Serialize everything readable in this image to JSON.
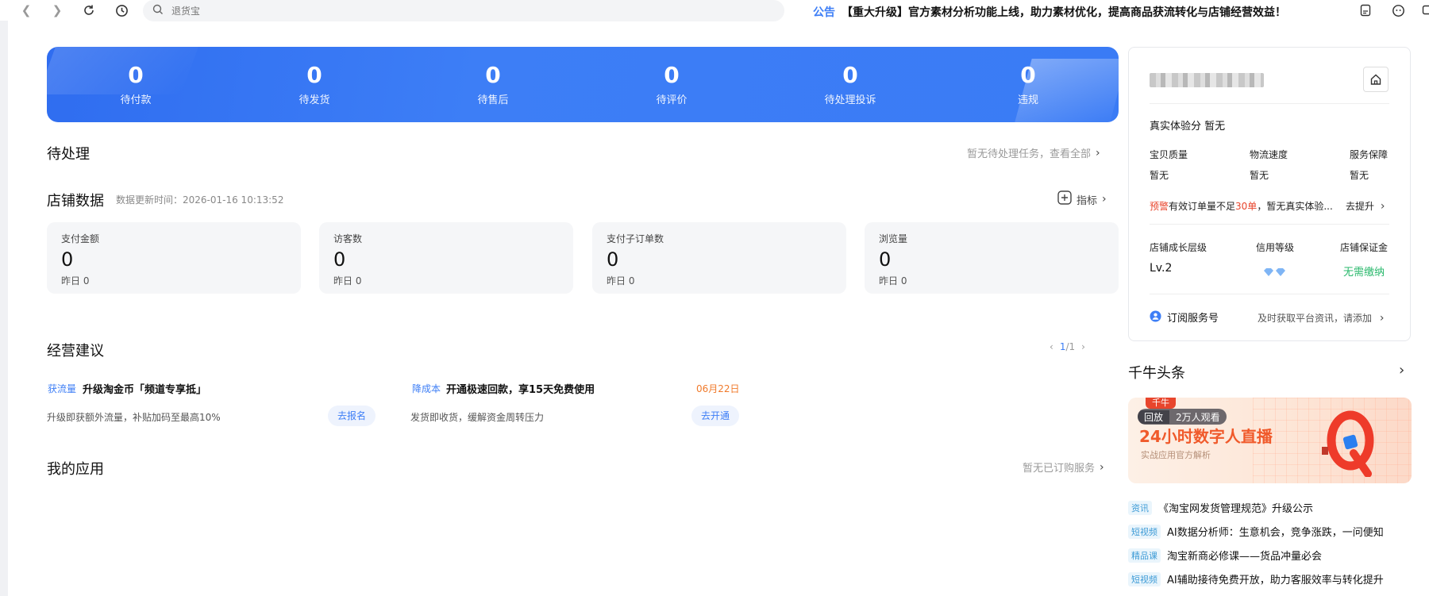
{
  "topbar": {
    "search_placeholder": "退货宝",
    "notice_label": "公告",
    "notice_text": "【重大升级】官方素材分析功能上线，助力素材优化，提高商品获流转化与店铺经营效益！"
  },
  "banner": {
    "stats": [
      {
        "value": "0",
        "label": "待付款"
      },
      {
        "value": "0",
        "label": "待发货"
      },
      {
        "value": "0",
        "label": "待售后"
      },
      {
        "value": "0",
        "label": "待评价"
      },
      {
        "value": "0",
        "label": "待处理投诉"
      },
      {
        "value": "0",
        "label": "违规"
      }
    ]
  },
  "pending": {
    "title": "待处理",
    "link": "暂无待处理任务，查看全部"
  },
  "shop_data": {
    "title": "店铺数据",
    "update_time": "数据更新时间：2026-01-16 10:13:52",
    "indicator_label": "指标",
    "metrics": [
      {
        "label": "支付金额",
        "value": "0",
        "yesterday": "昨日 0"
      },
      {
        "label": "访客数",
        "value": "0",
        "yesterday": "昨日 0"
      },
      {
        "label": "支付子订单数",
        "value": "0",
        "yesterday": "昨日 0"
      },
      {
        "label": "浏览量",
        "value": "0",
        "yesterday": "昨日 0"
      }
    ]
  },
  "suggestions": {
    "title": "经营建议",
    "pager": {
      "current": "1",
      "separator": "/",
      "total": "1"
    },
    "items": [
      {
        "tag": "获流量",
        "title": "升级淘金币「频道专享抵」",
        "desc": "升级即获额外流量，补贴加码至最高10%",
        "button": "去报名",
        "date": ""
      },
      {
        "tag": "降成本",
        "title": "开通极速回款，享15天免费使用",
        "desc": "发货即收货，缓解资金周转压力",
        "button": "去开通",
        "date": "06月22日"
      }
    ]
  },
  "my_apps": {
    "title": "我的应用",
    "link": "暂无已订购服务"
  },
  "shop_card": {
    "experience_score": "真实体验分  暂无",
    "scores": [
      {
        "label": "宝贝质量",
        "value": "暂无"
      },
      {
        "label": "物流速度",
        "value": "暂无"
      },
      {
        "label": "服务保障",
        "value": "暂无"
      }
    ],
    "warning_prefix": "预警",
    "warning_mid1": "有效订单量不足",
    "warning_highlight": "30单",
    "warning_mid2": "，暂无真实体验...",
    "warning_action": "去提升",
    "levels": [
      {
        "label": "店铺成长层级",
        "value": "Lv.2"
      },
      {
        "label": "信用等级",
        "value": ""
      },
      {
        "label": "店铺保证金",
        "value": "无需缴纳"
      }
    ],
    "subscribe_label": "订阅服务号",
    "subscribe_desc": "及时获取平台资讯，请添加"
  },
  "headlines": {
    "title": "千牛头条",
    "promo": {
      "top_tag": "千牛",
      "badge_left": "回放",
      "badge_right": "2万人观看",
      "title": "24小时数字人直播",
      "subtitle": "实战应用官方解析"
    },
    "news": [
      {
        "tag": "资讯",
        "title": "《淘宝网发货管理规范》升级公示"
      },
      {
        "tag": "短视频",
        "title": "AI数据分析师：生意机会，竞争涨跌，一问便知"
      },
      {
        "tag": "精品课",
        "title": "淘宝新商必修课——货品冲量必会"
      },
      {
        "tag": "短视频",
        "title": "AI辅助接待免费开放，助力客服效率与转化提升"
      }
    ]
  },
  "colors": {
    "accent": "#3d7ef6",
    "warning": "#e8452c",
    "success": "#28b86b",
    "date": "#f07a2b"
  }
}
